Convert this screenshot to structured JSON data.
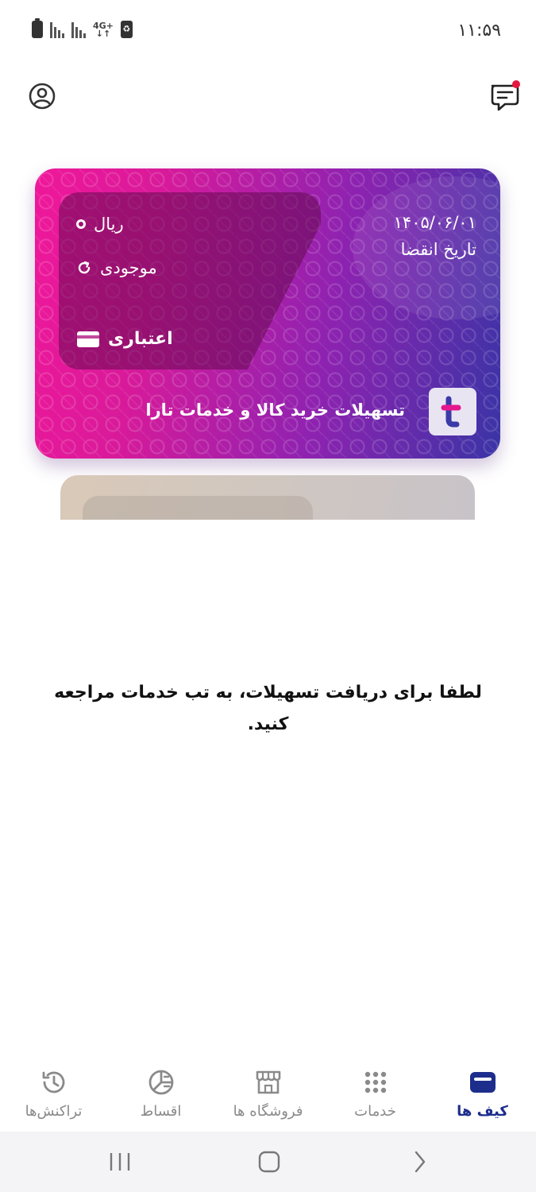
{
  "status_bar": {
    "time": "۱۱:۵۹",
    "network_label": "4G+",
    "icons": [
      "battery-icon",
      "signal-icon",
      "signal-icon",
      "network-4g-icon",
      "recycle-battery-icon"
    ]
  },
  "header": {
    "left_icon": "profile-icon",
    "right_icon": "messages-icon",
    "notification_color": "#e5173f"
  },
  "card": {
    "currency": "ریال",
    "balance_label": "موجودی",
    "type_label": "اعتباری",
    "expiry_date": "۱۴۰۵/۰۶/۰۱",
    "expiry_label": "تاریخ انقضا",
    "title": "تسهیلات خرید کالا و خدمات تارا",
    "gradient_colors": [
      "#f0179a",
      "#8f22b0",
      "#3a34a6"
    ]
  },
  "message": "لطفا برای دریافت تسهیلات، به تب خدمات مراجعه کنید.",
  "bottom_nav": {
    "active_color": "#1d2d8c",
    "inactive_color": "#8a8a8a",
    "items": [
      {
        "label": "کیف ها",
        "icon": "wallet-icon",
        "active": true
      },
      {
        "label": "خدمات",
        "icon": "grid-dots-icon",
        "active": false
      },
      {
        "label": "فروشگاه ها",
        "icon": "store-icon",
        "active": false
      },
      {
        "label": "اقساط",
        "icon": "installments-icon",
        "active": false
      },
      {
        "label": "تراکنش‌ها",
        "icon": "history-icon",
        "active": false
      }
    ]
  },
  "system_nav": {
    "icons": [
      "recents-icon",
      "home-icon",
      "back-icon"
    ]
  }
}
